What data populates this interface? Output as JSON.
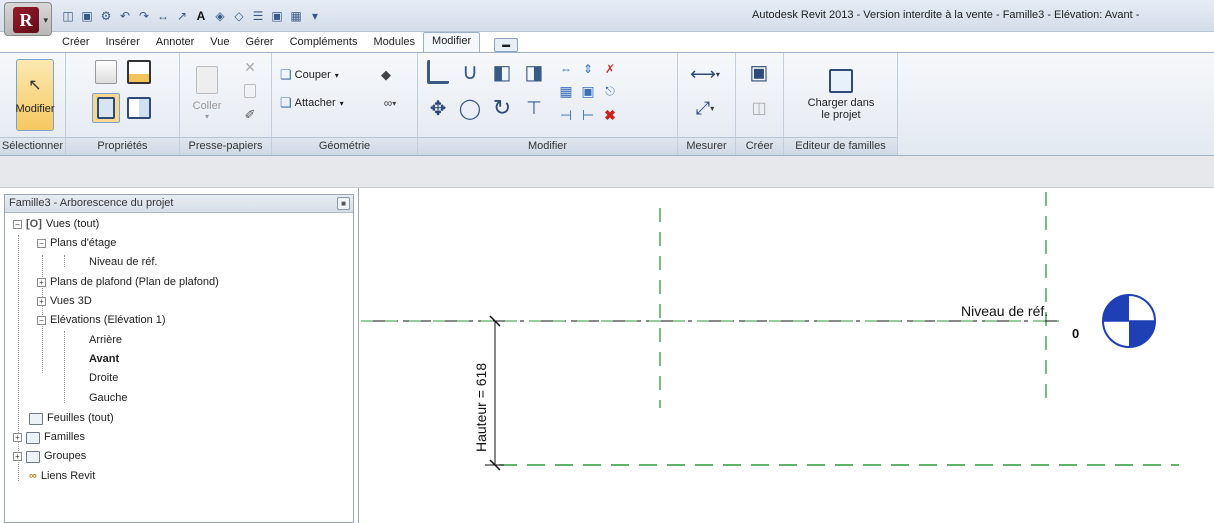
{
  "window": {
    "title": "Autodesk Revit 2013 - Version interdite à la vente -    Famille3 - Elévation: Avant -"
  },
  "ribbon": {
    "tabs": [
      "Créer",
      "Insérer",
      "Annoter",
      "Vue",
      "Gérer",
      "Compléments",
      "Modules",
      "Modifier"
    ],
    "active_tab": "Modifier",
    "panels": {
      "selectionner": {
        "title": "Sélectionner",
        "modifier_label": "Modifier"
      },
      "proprietes": {
        "title": "Propriétés"
      },
      "presse_papiers": {
        "title": "Presse-papiers",
        "coller_label": "Coller"
      },
      "geometrie": {
        "title": "Géométrie",
        "couper_label": "Couper",
        "attacher_label": "Attacher"
      },
      "modifier": {
        "title": "Modifier"
      },
      "mesurer": {
        "title": "Mesurer"
      },
      "creer": {
        "title": "Créer"
      },
      "editeur": {
        "title": "Editeur de familles",
        "charger_label_1": "Charger dans",
        "charger_label_2": "le projet"
      }
    }
  },
  "browser": {
    "title": "Famille3 - Arborescence du projet",
    "items": [
      {
        "label": "Vues (tout)"
      },
      {
        "label": "Plans d'étage"
      },
      {
        "label": "Niveau de réf."
      },
      {
        "label": "Plans de plafond (Plan de plafond)"
      },
      {
        "label": "Vues 3D"
      },
      {
        "label": "Elévations (Elévation 1)"
      },
      {
        "label": "Arrière"
      },
      {
        "label": "Avant"
      },
      {
        "label": "Droite"
      },
      {
        "label": "Gauche"
      },
      {
        "label": "Feuilles (tout)"
      },
      {
        "label": "Familles"
      },
      {
        "label": "Groupes"
      },
      {
        "label": "Liens Revit"
      }
    ]
  },
  "drawing": {
    "level_name": "Niveau de réf.",
    "level_elevation": "0",
    "dimension_label": "Hauteur = 618",
    "colors": {
      "reference_plane": "#2e9a3c",
      "level_head": "#1f3fb5"
    }
  }
}
